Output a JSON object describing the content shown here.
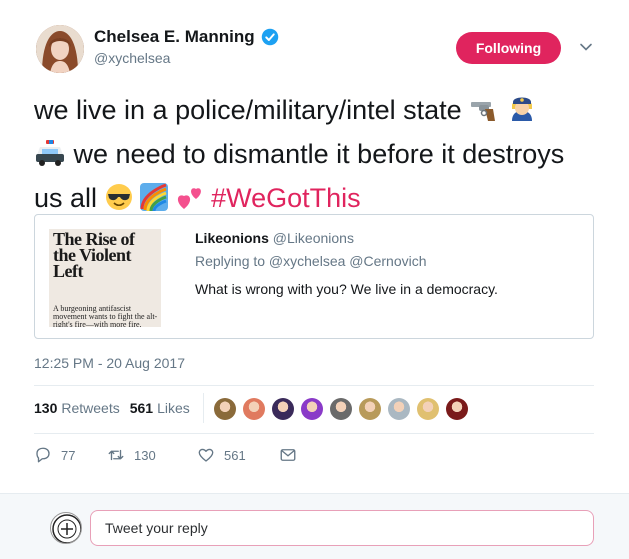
{
  "author": {
    "name": "Chelsea E. Manning",
    "handle": "@xychelsea",
    "verified": true,
    "avatar_icon": "profile-photo"
  },
  "follow_button": {
    "label": "Following",
    "color": "#e0245e"
  },
  "tweet": {
    "line1": "we live in a police/military/intel state",
    "line1_emojis": [
      "🔫",
      "👮‍♀️"
    ],
    "line2_emoji": "🚓",
    "line2": "we need to dismantle it before it destroys",
    "line3": "us all",
    "line3_emojis": [
      "😎",
      "🌈",
      "💕"
    ],
    "hashtag": "#WeGotThis"
  },
  "quoted": {
    "image_title": "The Rise of the Violent Left",
    "image_subtitle": "A burgeoning antifascist movement wants to fight the alt-right's fire—with more fire.",
    "name": "Likeonions",
    "handle": "@Likeonions",
    "replying_to": "Replying to @xychelsea @Cernovich",
    "text": "What is wrong with you? We live in a democracy."
  },
  "timestamp": "12:25 PM - 20 Aug 2017",
  "stats": {
    "retweets_count": "130",
    "retweets_label": "Retweets",
    "likes_count": "561",
    "likes_label": "Likes"
  },
  "likers": [
    "#8a6a3a",
    "#e07a5f",
    "#3a2a5a",
    "#8a3ac8",
    "#6a6a6a",
    "#b89a5a",
    "#aab8c2",
    "#e0c070",
    "#7a1a1a"
  ],
  "actions": {
    "reply_count": "77",
    "retweet_count": "130",
    "like_count": "561"
  },
  "reply_box": {
    "placeholder": "Tweet your reply"
  },
  "colors": {
    "accent": "#e0245e",
    "verified": "#1da1f2",
    "muted": "#657786"
  }
}
